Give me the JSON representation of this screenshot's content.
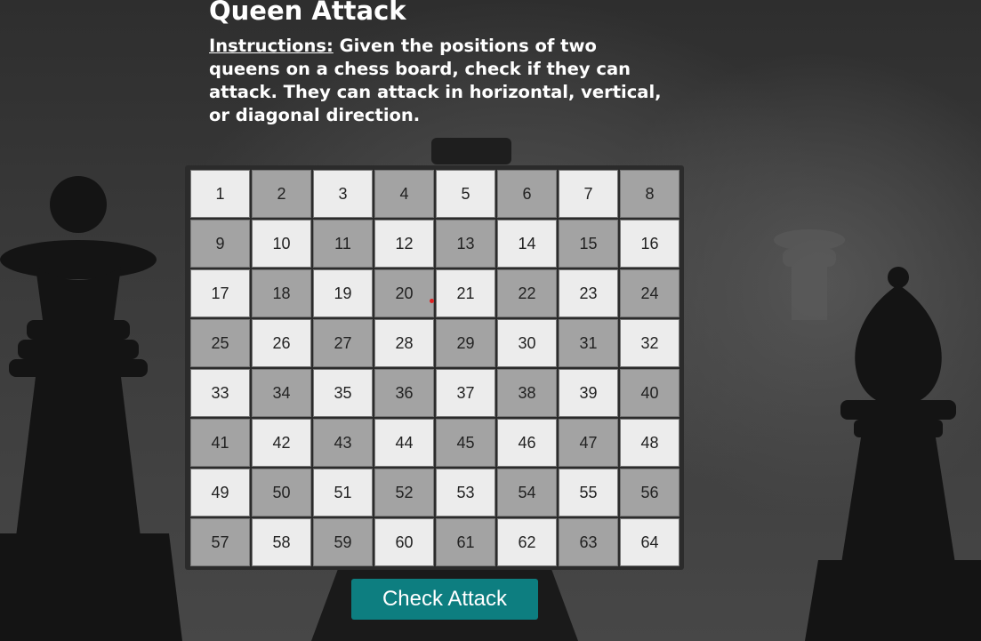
{
  "page": {
    "title": "Queen Attack",
    "instructions_label": "Instructions:",
    "instructions_text": " Given the positions of two queens on a chess board, check if they can attack. They can attack in horizontal, vertical, or diagonal direction."
  },
  "board": {
    "rows": 8,
    "cols": 8,
    "cells": [
      "1",
      "2",
      "3",
      "4",
      "5",
      "6",
      "7",
      "8",
      "9",
      "10",
      "11",
      "12",
      "13",
      "14",
      "15",
      "16",
      "17",
      "18",
      "19",
      "20",
      "21",
      "22",
      "23",
      "24",
      "25",
      "26",
      "27",
      "28",
      "29",
      "30",
      "31",
      "32",
      "33",
      "34",
      "35",
      "36",
      "37",
      "38",
      "39",
      "40",
      "41",
      "42",
      "43",
      "44",
      "45",
      "46",
      "47",
      "48",
      "49",
      "50",
      "51",
      "52",
      "53",
      "54",
      "55",
      "56",
      "57",
      "58",
      "59",
      "60",
      "61",
      "62",
      "63",
      "64"
    ],
    "light_color": "#ececec",
    "dark_color": "#a3a3a3"
  },
  "actions": {
    "check_label": "Check Attack",
    "check_color": "#0d7e80"
  }
}
